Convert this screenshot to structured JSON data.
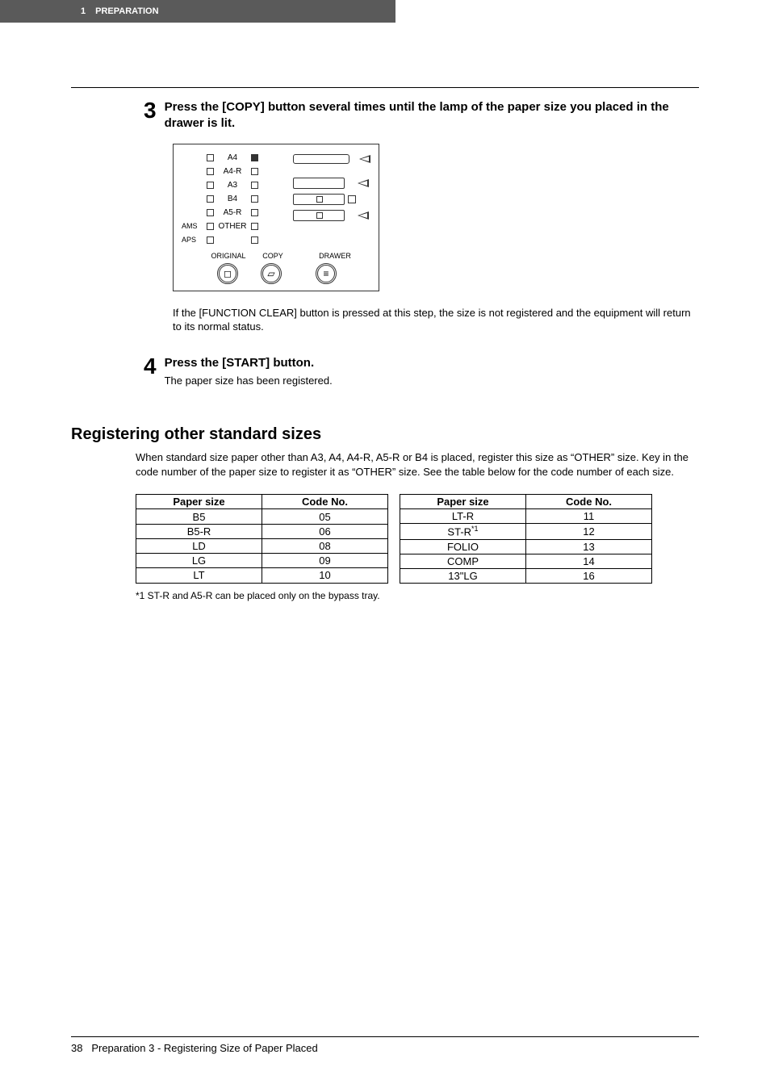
{
  "header": {
    "chapter_num": "1",
    "chapter_title": "PREPARATION"
  },
  "step3": {
    "num": "3",
    "title": "Press the [COPY] button several times until the lamp of the paper size you placed in the drawer is lit."
  },
  "diagram": {
    "sizes": [
      "A4",
      "A4-R",
      "A3",
      "B4",
      "A5-R",
      "OTHER"
    ],
    "ams": "AMS",
    "aps": "APS",
    "labels": {
      "original": "ORIGINAL",
      "copy": "COPY",
      "drawer": "DRAWER"
    }
  },
  "step3_note": "If the [FUNCTION CLEAR] button is pressed at this step, the size is not registered and the equipment will return to its normal status.",
  "step4": {
    "num": "4",
    "title": "Press the [START] button.",
    "body": "The paper size has been registered."
  },
  "section": {
    "heading": "Registering other standard sizes",
    "body": "When standard size paper other than A3, A4, A4-R, A5-R or B4 is placed, register this size as “OTHER” size. Key in the code number of the paper size to register it as “OTHER” size. See the table below for the code number of each size."
  },
  "tables": {
    "headers": {
      "size": "Paper size",
      "code": "Code No."
    },
    "left": [
      {
        "size": "B5",
        "code": "05"
      },
      {
        "size": "B5-R",
        "code": "06"
      },
      {
        "size": "LD",
        "code": "08"
      },
      {
        "size": "LG",
        "code": "09"
      },
      {
        "size": "LT",
        "code": "10"
      }
    ],
    "right": [
      {
        "size_html": "LT-R",
        "code": "11"
      },
      {
        "size_html": "ST-R",
        "sup": "*1",
        "code": "12"
      },
      {
        "size_html": "FOLIO",
        "code": "13"
      },
      {
        "size_html": "COMP",
        "code": "14"
      },
      {
        "size_html": "13\"LG",
        "code": "16"
      }
    ]
  },
  "footnote": "*1   ST-R and A5-R can be placed only on the bypass tray.",
  "footer": {
    "page": "38",
    "text": "Preparation 3 - Registering Size of Paper Placed"
  },
  "chart_data": {
    "type": "table",
    "title": "Paper size code numbers",
    "columns": [
      "Paper size",
      "Code No."
    ],
    "rows": [
      [
        "B5",
        "05"
      ],
      [
        "B5-R",
        "06"
      ],
      [
        "LD",
        "08"
      ],
      [
        "LG",
        "09"
      ],
      [
        "LT",
        "10"
      ],
      [
        "LT-R",
        "11"
      ],
      [
        "ST-R",
        "12"
      ],
      [
        "FOLIO",
        "13"
      ],
      [
        "COMP",
        "14"
      ],
      [
        "13\"LG",
        "16"
      ]
    ]
  }
}
